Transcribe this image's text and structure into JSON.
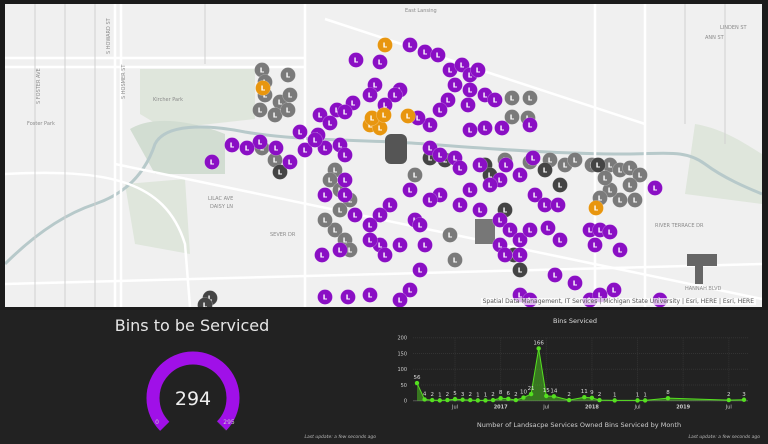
{
  "map": {
    "labels": {
      "east_lansing": "East Lansing",
      "kircher_park": "Kircher Park",
      "foster_park": "Foster Park",
      "lilac_ave": "LILAC AVE",
      "daisy_ln": "DAISY LN",
      "sever_dr": "SEVER DR",
      "s_howard": "S HOWARD ST",
      "s_hosmer": "S HOSMER ST",
      "s_foster": "S FOSTER AVE",
      "linden": "LINDEN ST",
      "ann": "ANN ST",
      "hannah": "HANNAH BLVD",
      "river_terrace": "RIVER TERRACE DR"
    },
    "marker_letter": "L",
    "marker_colors": {
      "open": "#8a0fc4",
      "serviced": "#7a7a7a",
      "dark": "#444444",
      "flagged": "#e8960f"
    },
    "attribution": "Spatial Data Management, IT Services | Michigan State University | Esri, HERE | Esri, HERE"
  },
  "gauge": {
    "title": "Bins to be Serviced",
    "value": 294,
    "min": 0,
    "max": 295,
    "min_label": "0",
    "max_label": "295",
    "value_label": "294",
    "color": "#a010e8",
    "last_update": "Last update: a few seconds ago"
  },
  "chart_data": {
    "type": "area",
    "title": "Bins Serviced",
    "xlabel": "Number of Landsacpe Services Owned Bins Serviced by Month",
    "ylabel": "",
    "ylim": [
      0,
      200
    ],
    "yticks": [
      "0",
      "50",
      "100",
      "150",
      "200"
    ],
    "xticks": [
      "Jul",
      "2017",
      "Jul",
      "2018",
      "Jul",
      "2019",
      "Jul"
    ],
    "grid": true,
    "color": "#55e020",
    "x": [
      "2016-02",
      "2016-03",
      "2016-04",
      "2016-05",
      "2016-06",
      "2016-07",
      "2016-08",
      "2016-09",
      "2016-10",
      "2016-11",
      "2016-12",
      "2017-01",
      "2017-02",
      "2017-03",
      "2017-04",
      "2017-05",
      "2017-06",
      "2017-07",
      "2017-08",
      "2017-10",
      "2017-12",
      "2018-01",
      "2018-02",
      "2018-04",
      "2018-07",
      "2018-08",
      "2018-11",
      "2019-07",
      "2019-09"
    ],
    "values": [
      56,
      4,
      2,
      1,
      2,
      5,
      3,
      2,
      1,
      1,
      2,
      8,
      6,
      2,
      10,
      21,
      166,
      15,
      14,
      2,
      11,
      9,
      2,
      1,
      1,
      1,
      8,
      2,
      3
    ],
    "last_update": "Last update: a few seconds ago"
  }
}
